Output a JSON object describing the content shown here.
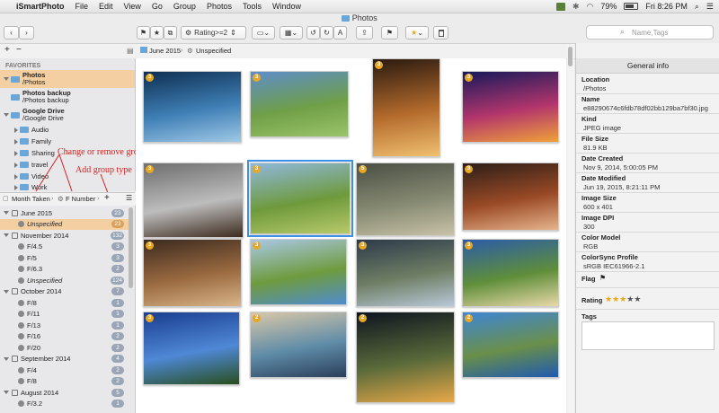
{
  "menubar": {
    "apple": "",
    "app": "iSmartPhoto",
    "items": [
      "File",
      "Edit",
      "View",
      "Go",
      "Group",
      "Photos",
      "Tools",
      "Window"
    ],
    "battery": "79%",
    "clock": "Fri 8:26 PM"
  },
  "window_title": "Photos",
  "toolbar": {
    "back": "‹",
    "forward": "›",
    "flag": "⚑",
    "star": "★",
    "copy": "⧉",
    "rating_filter": "Rating>=2",
    "rotate_left": "↺",
    "rotate_right": "↻",
    "show_all": "A",
    "share": "⇪",
    "flag2": "⚑",
    "star2": "★",
    "trash": "🗑",
    "search_placeholder": "Name,Tags"
  },
  "row2": {
    "add": "+",
    "remove": "−",
    "breadcrumb1": "June 2015",
    "breadcrumb2": "Unspecified"
  },
  "favorites_label": "FAVORITES",
  "favorites": [
    {
      "name": "Photos",
      "path": "/Photos"
    },
    {
      "name": "Photos backup",
      "path": "/Photos backup"
    },
    {
      "name": "Google Drive",
      "path": "/Google Drive"
    }
  ],
  "subfolders": [
    "Audio",
    "Family",
    "Sharing",
    "travel",
    "Video",
    "Work"
  ],
  "annotations": {
    "change_group": "Change or remove group type",
    "add_group": "Add group type"
  },
  "groupbar": {
    "item1": "Month Taken",
    "item2": "F Number",
    "add": "+"
  },
  "groups": [
    {
      "label": "June 2015",
      "count": "23",
      "kind": "month"
    },
    {
      "label": "Unspecified",
      "count": "23",
      "kind": "fnum",
      "selected": true
    },
    {
      "label": "November 2014",
      "count": "132",
      "kind": "month"
    },
    {
      "label": "F/4.5",
      "count": "3",
      "kind": "fnum"
    },
    {
      "label": "F/5",
      "count": "3",
      "kind": "fnum"
    },
    {
      "label": "F/6.3",
      "count": "2",
      "kind": "fnum"
    },
    {
      "label": "Unspecified",
      "count": "124",
      "kind": "fnum"
    },
    {
      "label": "October 2014",
      "count": "7",
      "kind": "month"
    },
    {
      "label": "F/8",
      "count": "1",
      "kind": "fnum"
    },
    {
      "label": "F/11",
      "count": "1",
      "kind": "fnum"
    },
    {
      "label": "F/13",
      "count": "1",
      "kind": "fnum"
    },
    {
      "label": "F/16",
      "count": "2",
      "kind": "fnum"
    },
    {
      "label": "F/20",
      "count": "2",
      "kind": "fnum"
    },
    {
      "label": "September 2014",
      "count": "4",
      "kind": "month"
    },
    {
      "label": "F/4",
      "count": "2",
      "kind": "fnum"
    },
    {
      "label": "F/8",
      "count": "2",
      "kind": "fnum"
    },
    {
      "label": "August 2014",
      "count": "5",
      "kind": "month"
    },
    {
      "label": "F/3.2",
      "count": "1",
      "kind": "fnum"
    }
  ],
  "thumbs": [
    {
      "badge": "3",
      "colors": [
        "#0e2f52",
        "#3f7fb5",
        "#9fc8e6"
      ]
    },
    {
      "badge": "3",
      "colors": [
        "#5d8dc9",
        "#6f9f47",
        "#9bc46a"
      ]
    },
    {
      "badge": "3",
      "colors": [
        "#2a1a10",
        "#b36a2c",
        "#f0c070"
      ]
    },
    {
      "badge": "3",
      "colors": [
        "#17195a",
        "#b2356c",
        "#f0a13a"
      ]
    },
    {
      "badge": "3",
      "colors": [
        "#6e6e6e",
        "#bdbdbd",
        "#3c2a1e"
      ]
    },
    {
      "badge": "3",
      "colors": [
        "#8fb8dd",
        "#6e9a3c",
        "#b8c96a"
      ]
    },
    {
      "badge": "5",
      "colors": [
        "#4b4f45",
        "#868a72",
        "#c8c2a8"
      ]
    },
    {
      "badge": "3",
      "colors": [
        "#2d1e18",
        "#9a4a26",
        "#e6b48c"
      ]
    },
    {
      "badge": "3",
      "colors": [
        "#3c2a1f",
        "#9a6a40",
        "#d9b48a"
      ]
    },
    {
      "badge": "3",
      "colors": [
        "#a9c8e6",
        "#6f9b3e",
        "#4f8ccf"
      ]
    },
    {
      "badge": "3",
      "colors": [
        "#2c3a4a",
        "#6e7e64",
        "#b8c8d8"
      ]
    },
    {
      "badge": "3",
      "colors": [
        "#2b5ca8",
        "#5f8e3a",
        "#e8d8a8"
      ]
    },
    {
      "badge": "3",
      "colors": [
        "#1a3d8f",
        "#4f88d6",
        "#284e1e"
      ]
    },
    {
      "badge": "2",
      "colors": [
        "#d9c7a8",
        "#5f8ca8",
        "#2a3f5a"
      ]
    },
    {
      "badge": "2",
      "colors": [
        "#0e1420",
        "#5a6a3a",
        "#e8a848"
      ]
    },
    {
      "badge": "2",
      "colors": [
        "#3f86d6",
        "#6a8f4a",
        "#1f5ab0"
      ]
    }
  ],
  "info": {
    "title": "General info",
    "fields": [
      {
        "label": "Location",
        "value": "/Photos"
      },
      {
        "label": "Name",
        "value": "e88290674c6fdb78df02bb129ba7bf30.jpg"
      },
      {
        "label": "Kind",
        "value": "JPEG image"
      },
      {
        "label": "File Size",
        "value": "81.9 KB"
      },
      {
        "label": "Date Created",
        "value": "Nov 9, 2014, 5:00:05 PM"
      },
      {
        "label": "Date Modified",
        "value": "Jun 19, 2015, 8:21:11 PM"
      },
      {
        "label": "Image Size",
        "value": "600 x 401"
      },
      {
        "label": "Image DPI",
        "value": "300"
      },
      {
        "label": "Color Model",
        "value": "RGB"
      },
      {
        "label": "ColorSync Profile",
        "value": "sRGB IEC61966-2.1"
      }
    ],
    "flag_label": "Flag",
    "flag_icon": "⚑",
    "rating_label": "Rating",
    "rating": 3,
    "rating_max": 5,
    "tags_label": "Tags"
  }
}
